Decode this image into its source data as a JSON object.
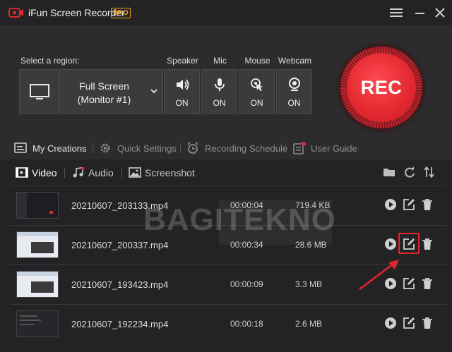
{
  "app": {
    "title": "iFun Screen Recorder",
    "badge": "PRO"
  },
  "panel": {
    "region_label": "Select a region:",
    "region_value_line1": "Full Screen",
    "region_value_line2": "(Monitor #1)",
    "devices": [
      {
        "label": "Speaker",
        "state": "ON",
        "icon": "speaker-icon"
      },
      {
        "label": "Mic",
        "state": "ON",
        "icon": "mic-icon"
      },
      {
        "label": "Mouse",
        "state": "ON",
        "icon": "mouse-click-icon"
      },
      {
        "label": "Webcam",
        "state": "ON",
        "icon": "webcam-icon"
      }
    ],
    "rec_label": "REC"
  },
  "nav": {
    "items": [
      {
        "label": "My Creations",
        "icon": "creations-icon"
      },
      {
        "label": "Quick Settings",
        "icon": "gear-icon"
      },
      {
        "label": "Recording Schedule",
        "icon": "alarm-clock-icon"
      },
      {
        "label": "User Guide",
        "icon": "guide-icon"
      }
    ]
  },
  "tabs": [
    {
      "label": "Video",
      "icon": "film-icon",
      "active": true
    },
    {
      "label": "Audio",
      "icon": "music-icon",
      "active": false
    },
    {
      "label": "Screenshot",
      "icon": "image-icon",
      "active": false
    }
  ],
  "files": [
    {
      "name": "20210607_203133.mp4",
      "duration": "00:00:04",
      "size": "719.4 KB"
    },
    {
      "name": "20210607_200337.mp4",
      "duration": "00:00:34",
      "size": "28.6 MB"
    },
    {
      "name": "20210607_193423.mp4",
      "duration": "00:00:09",
      "size": "3.3 MB"
    },
    {
      "name": "20210607_192234.mp4",
      "duration": "00:00:18",
      "size": "2.6 MB"
    }
  ],
  "watermark": "BAGITEKNO",
  "colors": {
    "accent": "#e3262d",
    "pro": "#f6a21c",
    "background": "#2b2b2d"
  }
}
